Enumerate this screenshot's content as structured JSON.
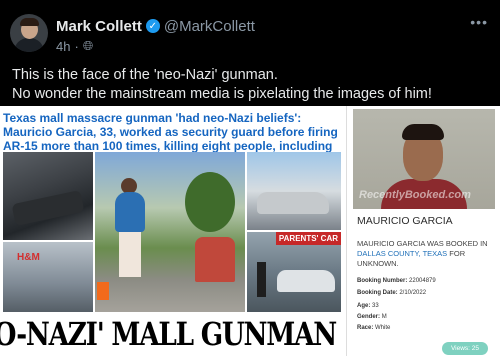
{
  "tweet": {
    "author_name": "Mark Collett",
    "handle": "@MarkCollett",
    "time": "4h",
    "globe_icon": "globe-icon",
    "more_icon": "more-dots",
    "line1": "This is the face of the 'neo-Nazi' gunman.",
    "line2": "No wonder the mainstream media is pixelating the images of him!"
  },
  "media": {
    "headline": "Texas mall massacre gunman 'had neo-Nazi beliefs': Mauricio Garcia, 33, worked as security guard before firing AR-15 more than 100 times, killing eight people, including children",
    "mall_logo": "H&M",
    "parents_car": "PARENTS' CAR",
    "banner": "'NEO-NAZI' MALL GUNMAN",
    "watermark": "RecentlyBooked.com",
    "card": {
      "name": "MAURICIO GARCIA",
      "desc_prefix": "MAURICIO GARCIA WAS BOOKED IN",
      "county": "DALLAS COUNTY, TEXAS",
      "desc_suffix": "FOR UNKNOWN.",
      "booking_number_label": "Booking Number:",
      "booking_number": "22004879",
      "booking_date_label": "Booking Date:",
      "booking_date": "2/10/2022",
      "age_label": "Age:",
      "age": "33",
      "gender_label": "Gender:",
      "gender": "M",
      "race_label": "Race:",
      "race": "White",
      "views_label": "Views:",
      "views": "25"
    }
  },
  "colors": {
    "verified": "#1d9bf0",
    "headline": "#1565c0",
    "link": "#1e6fb8",
    "views_badge": "#7fd1c0"
  }
}
